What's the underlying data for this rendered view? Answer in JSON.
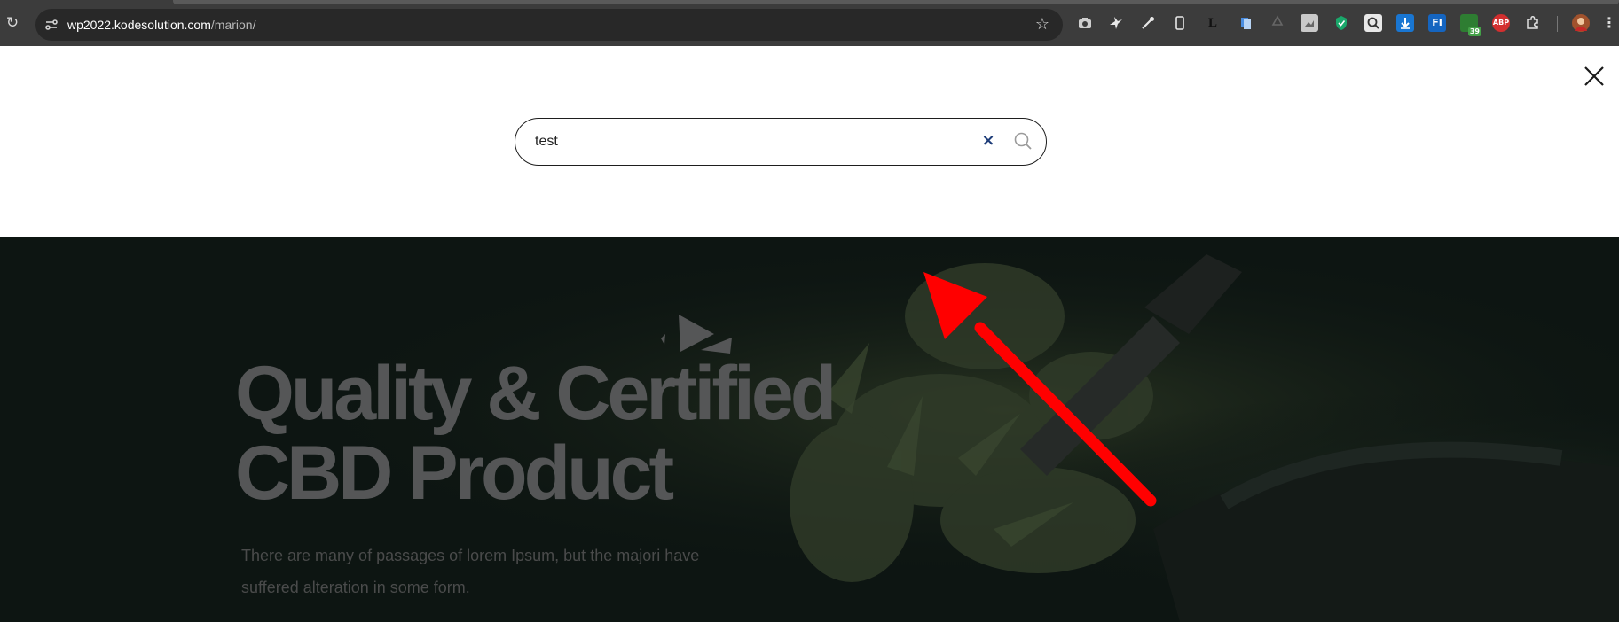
{
  "browser": {
    "url_host": "wp2022.kodesolution.com",
    "url_path": "/marion/",
    "extension_badge": "39",
    "abp_label": "ABP",
    "fi_label": "FI",
    "l_label": "L"
  },
  "search": {
    "value": "test",
    "clear_label": "×"
  },
  "hero": {
    "title_line1": "Quality & Certified",
    "title_line2": "CBD Product",
    "text": "There are many of passages of lorem Ipsum, but the majori have suffered alteration in some form."
  },
  "colors": {
    "accent_arrow": "#ff0000",
    "clear_icon": "#1e3d79",
    "hero_bg": "#0d1512"
  },
  "icons": [
    "reload-icon",
    "site-info-icon",
    "bookmark-star-icon",
    "close-icon",
    "search-icon",
    "clear-icon"
  ]
}
